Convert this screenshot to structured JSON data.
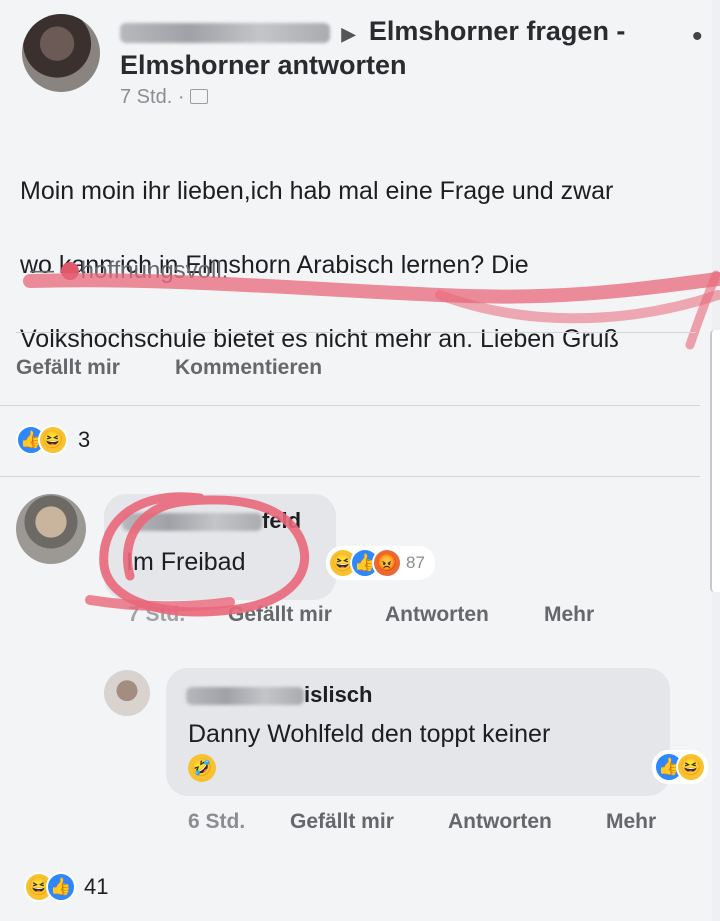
{
  "post": {
    "author_blurred": "",
    "group_name_line1": "Elmshorner fragen -",
    "group_name_line2": "Elmshorner antworten",
    "time": "7 Std.",
    "body_line1": "Moin moin ihr lieben,ich hab mal eine Frage und zwar",
    "body_line2": "wo kann ich in Elmshorn Arabisch lernen? Die",
    "body_line3": "Volkshochschule bietet es nicht mehr an. Lieben Gruß",
    "feeling": "hoffnungsvoll.",
    "like_label": "Gefällt mir",
    "comment_label": "Kommentieren",
    "reaction_count": "3"
  },
  "comment1": {
    "name_suffix": "feld",
    "text": "Im Freibad",
    "reaction_count": "87",
    "time": "7 Std.",
    "like_label": "Gefällt mir",
    "reply_label": "Antworten",
    "more_label": "Mehr"
  },
  "reply1": {
    "name_suffix": "islisch",
    "text": "Danny Wohlfeld den toppt keiner",
    "time": "6 Std.",
    "like_label": "Gefällt mir",
    "reply_label": "Antworten",
    "more_label": "Mehr"
  },
  "footer": {
    "reaction_count": "41"
  },
  "colors": {
    "highlight": "#e8677a",
    "like_blue": "#2d88ff",
    "haha_yellow": "#f7c130"
  }
}
